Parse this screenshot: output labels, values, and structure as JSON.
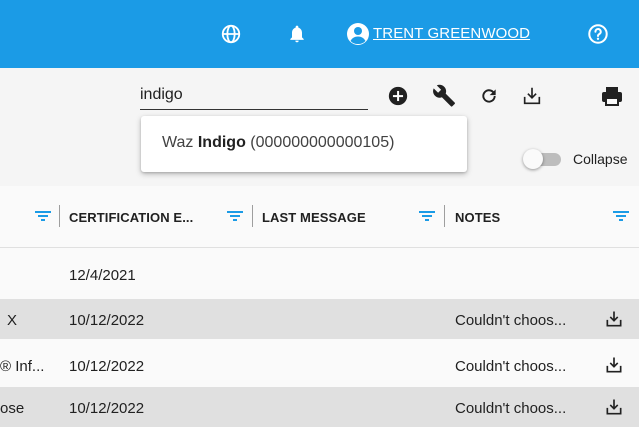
{
  "header": {
    "user_name": "TRENT GREENWOOD",
    "bg_color": "#1b9be6",
    "icons": [
      "globe-icon",
      "bell-icon",
      "account-circle-icon",
      "help-icon"
    ]
  },
  "search": {
    "value": "indigo",
    "placeholder": ""
  },
  "toolbar_icons": [
    "add-circle-icon",
    "wrench-icon",
    "refresh-icon",
    "download-icon",
    "print-icon"
  ],
  "autocomplete": {
    "prefix": "Waz ",
    "match": "Indigo",
    "suffix": " (000000000000105)"
  },
  "collapse": {
    "label": "Collapse",
    "on": false
  },
  "columns": [
    {
      "label": "CERTIFICATION E..."
    },
    {
      "label": "LAST MESSAGE"
    },
    {
      "label": "NOTES"
    }
  ],
  "rows": [
    {
      "name": "",
      "cert": "12/4/2021",
      "notes": "",
      "download": false
    },
    {
      "name": "X",
      "cert": "10/12/2022",
      "notes": "Couldn't choos...",
      "download": true
    },
    {
      "name": "® Inf...",
      "cert": "10/12/2022",
      "notes": "Couldn't choos...",
      "download": true
    },
    {
      "name": "ose",
      "cert": "10/12/2022",
      "notes": "Couldn't choos...",
      "download": true
    }
  ]
}
